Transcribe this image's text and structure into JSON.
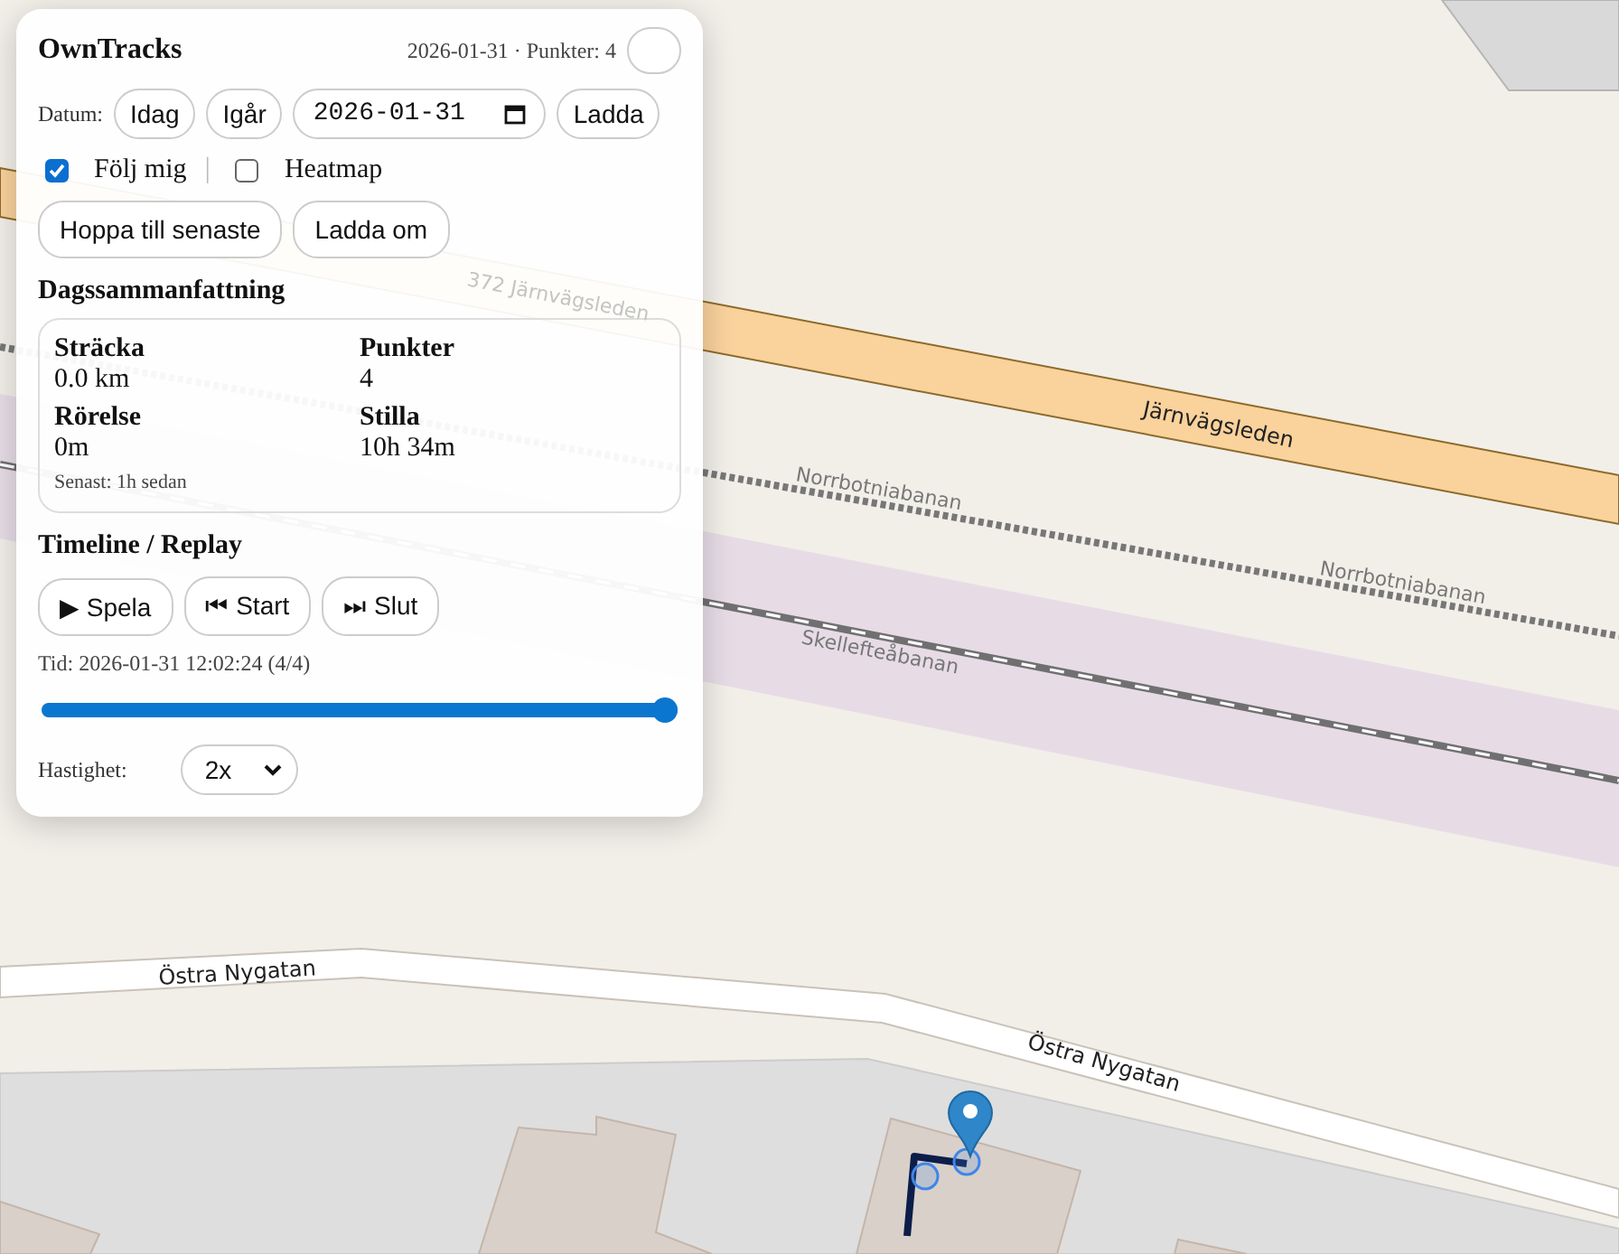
{
  "map": {
    "road_labels": [
      "372 Järnvägsleden",
      "Järnvägsleden",
      "Norrbotniabanan",
      "Norrbotniabanan",
      "Skellefteåbanan",
      "Östra Nygatan",
      "Östra Nygatan"
    ]
  },
  "panel": {
    "title": "OwnTracks",
    "meta": "2026-01-31 · Punkter: 4",
    "date_row": {
      "label": "Datum:",
      "buttons": [
        "Idag",
        "Igår"
      ],
      "date": "2026-01-31",
      "load": "Ladda"
    },
    "toggles": [
      {
        "label": "Följ mig",
        "checked": true
      },
      {
        "label": "Heatmap",
        "checked": false
      }
    ],
    "toggle_separator": "|",
    "actions": [
      "Hoppa till senaste",
      "Ladda om"
    ],
    "summary": {
      "heading": "Dagssammanfattning",
      "stats": [
        {
          "label": "Sträcka",
          "value": "0.0 km"
        },
        {
          "label": "Punkter",
          "value": "4"
        },
        {
          "label": "Rörelse",
          "value": "0m"
        },
        {
          "label": "Stilla",
          "value": "10h 34m"
        }
      ],
      "last": "Senast: 1h sedan"
    },
    "timeline": {
      "heading": "Timeline / Replay",
      "buttons": [
        "▶ Spela",
        "⏮ Start",
        "⏭ Slut"
      ],
      "time": "Tid: 2026-01-31 12:02:24 (4/4)",
      "slider": {
        "level": 1
      },
      "speed_label": "Hastighet:",
      "speed": "2x"
    }
  }
}
